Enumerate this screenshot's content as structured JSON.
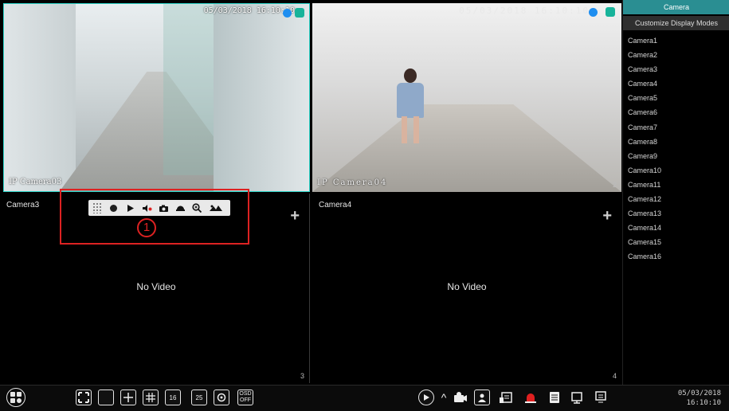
{
  "tiles": [
    {
      "timestamp": "05/03/2018 16:10:10",
      "osd_name": "IP Camera03"
    },
    {
      "timestamp": "05/03/2018 16:10:10",
      "osd_name": "IP Camera04",
      "number": "2"
    },
    {
      "title": "Camera3",
      "status": "No Video",
      "number": "3"
    },
    {
      "title": "Camera4",
      "status": "No Video",
      "number": "4"
    }
  ],
  "toolbar_marker": "1",
  "toolbar_icons": [
    "record-icon",
    "playback-icon",
    "mute-icon",
    "snapshot-icon",
    "ptz-icon",
    "zoom-icon",
    "image-adjust-icon"
  ],
  "panel": {
    "tab_label": "Camera",
    "customize_label": "Customize Display Modes",
    "cameras": [
      "Camera1",
      "Camera2",
      "Camera3",
      "Camera4",
      "Camera5",
      "Camera6",
      "Camera7",
      "Camera8",
      "Camera9",
      "Camera10",
      "Camera11",
      "Camera12",
      "Camera13",
      "Camera14",
      "Camera15",
      "Camera16"
    ]
  },
  "bottom": {
    "osd_label_top": "OSD",
    "osd_label_bottom": "OFF",
    "multi_screen_labels": [
      "16",
      "25"
    ],
    "date": "05/03/2018",
    "time": "16:10:10"
  },
  "colors": {
    "accent": "#2a8e92",
    "highlight": "#dd2222",
    "selected_border": "#2dd5c9"
  }
}
